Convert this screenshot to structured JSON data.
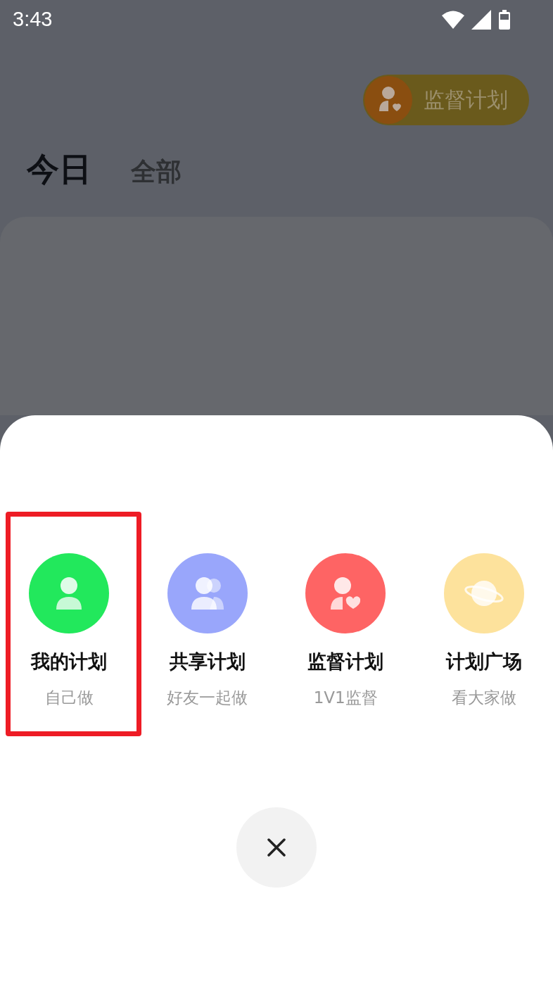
{
  "status_bar": {
    "time": "3:43"
  },
  "header": {
    "supervise_button": "监督计划"
  },
  "tabs": [
    {
      "label": "今日",
      "selected": true
    },
    {
      "label": "全部",
      "selected": false
    }
  ],
  "sheet": {
    "options": [
      {
        "kind": "person",
        "color": "#22e85c",
        "title": "我的计划",
        "subtitle": "自己做",
        "highlighted": true
      },
      {
        "kind": "people",
        "color": "#99a6fb",
        "title": "共享计划",
        "subtitle": "好友一起做",
        "highlighted": false
      },
      {
        "kind": "person-heart",
        "color": "#fe6464",
        "title": "监督计划",
        "subtitle": "1V1监督",
        "highlighted": false
      },
      {
        "kind": "planet",
        "color": "#fde29c",
        "title": "计划广场",
        "subtitle": "看大家做",
        "highlighted": false
      }
    ]
  }
}
